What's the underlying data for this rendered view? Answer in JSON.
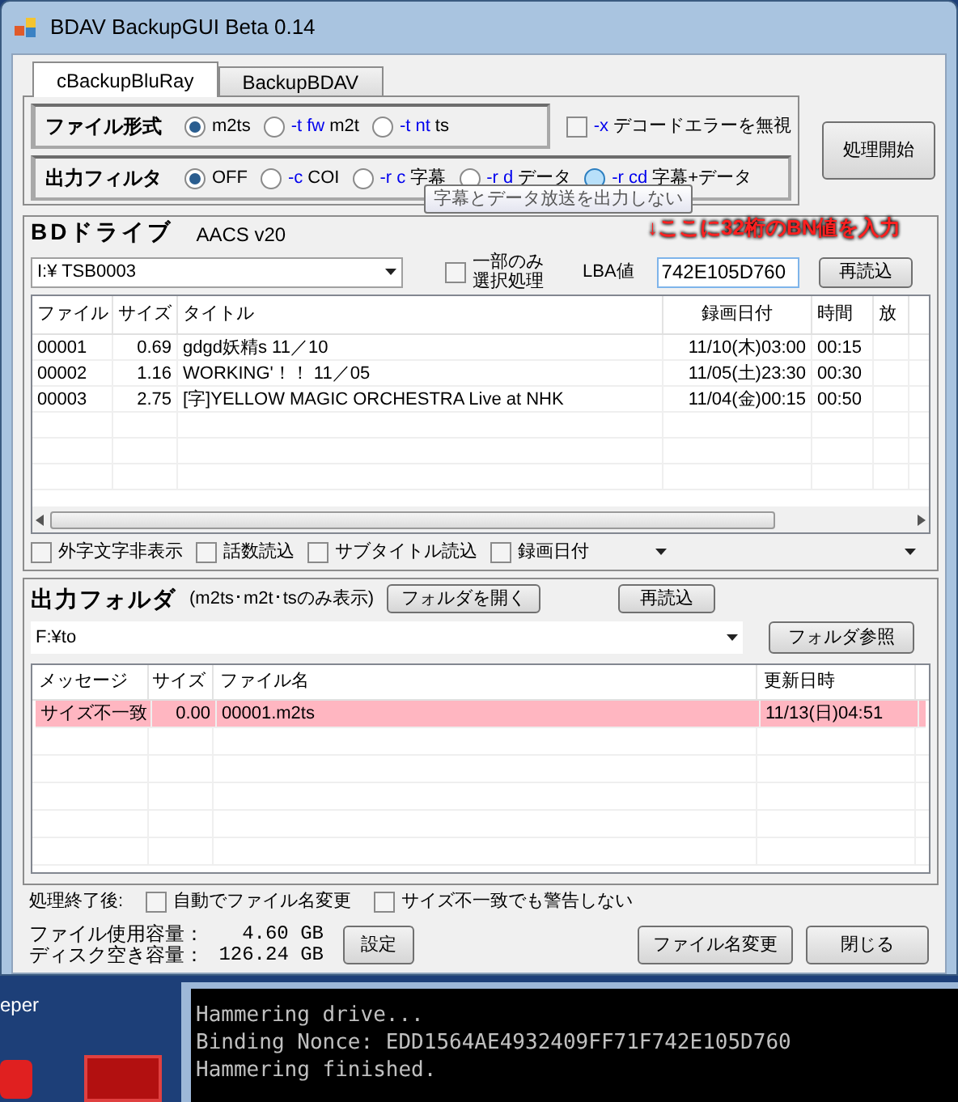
{
  "window": {
    "title": "BDAV BackupGUI Beta 0.14"
  },
  "tabs": [
    {
      "label": "cBackupBluRay",
      "selected": true
    },
    {
      "label": "BackupBDAV",
      "selected": false
    }
  ],
  "file_format": {
    "label": "ファイル形式",
    "options": [
      {
        "label": "m2ts",
        "selected": true
      },
      {
        "flag": "-t fw",
        "label": "m2t",
        "selected": false
      },
      {
        "flag": "-t nt",
        "label": "ts",
        "selected": false
      }
    ]
  },
  "ignore_decode_error": {
    "flag": "-x",
    "label": "デコードエラーを無視",
    "checked": false
  },
  "output_filter": {
    "label": "出力フィルタ",
    "options": [
      {
        "label": "OFF",
        "selected": true
      },
      {
        "flag": "-c",
        "label": "COI",
        "selected": false
      },
      {
        "flag": "-r c",
        "label": "字幕",
        "selected": false
      },
      {
        "flag": "-r d",
        "label": "データ",
        "selected": false
      },
      {
        "flag": "-r cd",
        "label": "字幕+データ",
        "selected": false,
        "hovered": true
      }
    ]
  },
  "start_button": "処理開始",
  "tooltip": "字幕とデータ放送を出力しない",
  "annotation": "↓ここに32桁のBN値を入力",
  "bd_drive": {
    "title": "BDドライブ",
    "aacs": "AACS v20",
    "drive": "I:¥ TSB0003",
    "partial": {
      "label": "一部のみ選択処理",
      "checked": false
    },
    "lba_label": "LBA値",
    "lba_value": "742E105D760",
    "reload": "再読込"
  },
  "titles_table": {
    "columns": [
      "ファイル",
      "サイズ",
      "タイトル",
      "録画日付",
      "時間",
      "放"
    ],
    "rows": [
      [
        "00001",
        "0.69",
        "gdgd妖精s 11／10",
        "11/10(木)03:00",
        "00:15",
        ""
      ],
      [
        "00002",
        "1.16",
        "WORKING'！！ 11／05",
        "11/05(土)23:30",
        "00:30",
        ""
      ],
      [
        "00003",
        "2.75",
        "[字]YELLOW MAGIC ORCHESTRA Live at NHK",
        "11/04(金)00:15",
        "00:50",
        ""
      ]
    ]
  },
  "title_options": [
    {
      "label": "外字文字非表示",
      "checked": false
    },
    {
      "label": "話数読込",
      "checked": false
    },
    {
      "label": "サブタイトル読込",
      "checked": false
    },
    {
      "label": "録画日付",
      "checked": false
    }
  ],
  "output_folder": {
    "title": "出力フォルダ",
    "note": "(m2ts･m2t･tsのみ表示)",
    "open": "フォルダを開く",
    "reload": "再読込",
    "path": "F:¥to",
    "browse": "フォルダ参照"
  },
  "files_table": {
    "columns": [
      "メッセージ",
      "サイズ",
      "ファイル名",
      "更新日時"
    ],
    "rows": [
      {
        "cells": [
          "サイズ不一致",
          "0.00",
          "00001.m2ts",
          "11/13(日)04:51"
        ],
        "warning": true
      }
    ]
  },
  "after_processing": {
    "label": "処理終了後:",
    "options": [
      {
        "label": "自動でファイル名変更",
        "checked": false
      },
      {
        "label": "サイズ不一致でも警告しない",
        "checked": false
      }
    ]
  },
  "usage": [
    {
      "label": "ファイル使用容量：",
      "value": "4.60 GB"
    },
    {
      "label": "ディスク空き容量：",
      "value": "126.24 GB"
    }
  ],
  "settings_button": "設定",
  "rename_button": "ファイル名変更",
  "close_button": "閉じる",
  "desktop": {
    "icon_label": "eper"
  },
  "console": [
    "Hammering drive...",
    "Binding Nonce: EDD1564AE4932409FF71F742E105D760",
    "Hammering finished."
  ]
}
